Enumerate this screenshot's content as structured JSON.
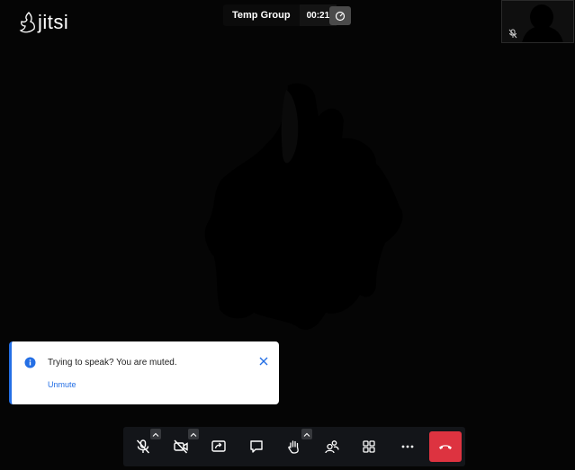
{
  "app": {
    "logo_text": "jitsi"
  },
  "header": {
    "subject": "Temp Group",
    "timer": "00:21"
  },
  "notification": {
    "title": "Trying to speak? You are muted.",
    "action": "Unmute"
  },
  "colors": {
    "accent": "#246fe5",
    "hangup": "#dd3340",
    "toolbar": "#131519"
  },
  "toolbar": {
    "buttons": [
      "microphone-muted-icon",
      "camera-off-icon",
      "screenshare-icon",
      "chat-icon",
      "raise-hand-icon",
      "participants-icon",
      "tile-view-icon",
      "more-icon",
      "hangup-icon"
    ]
  }
}
